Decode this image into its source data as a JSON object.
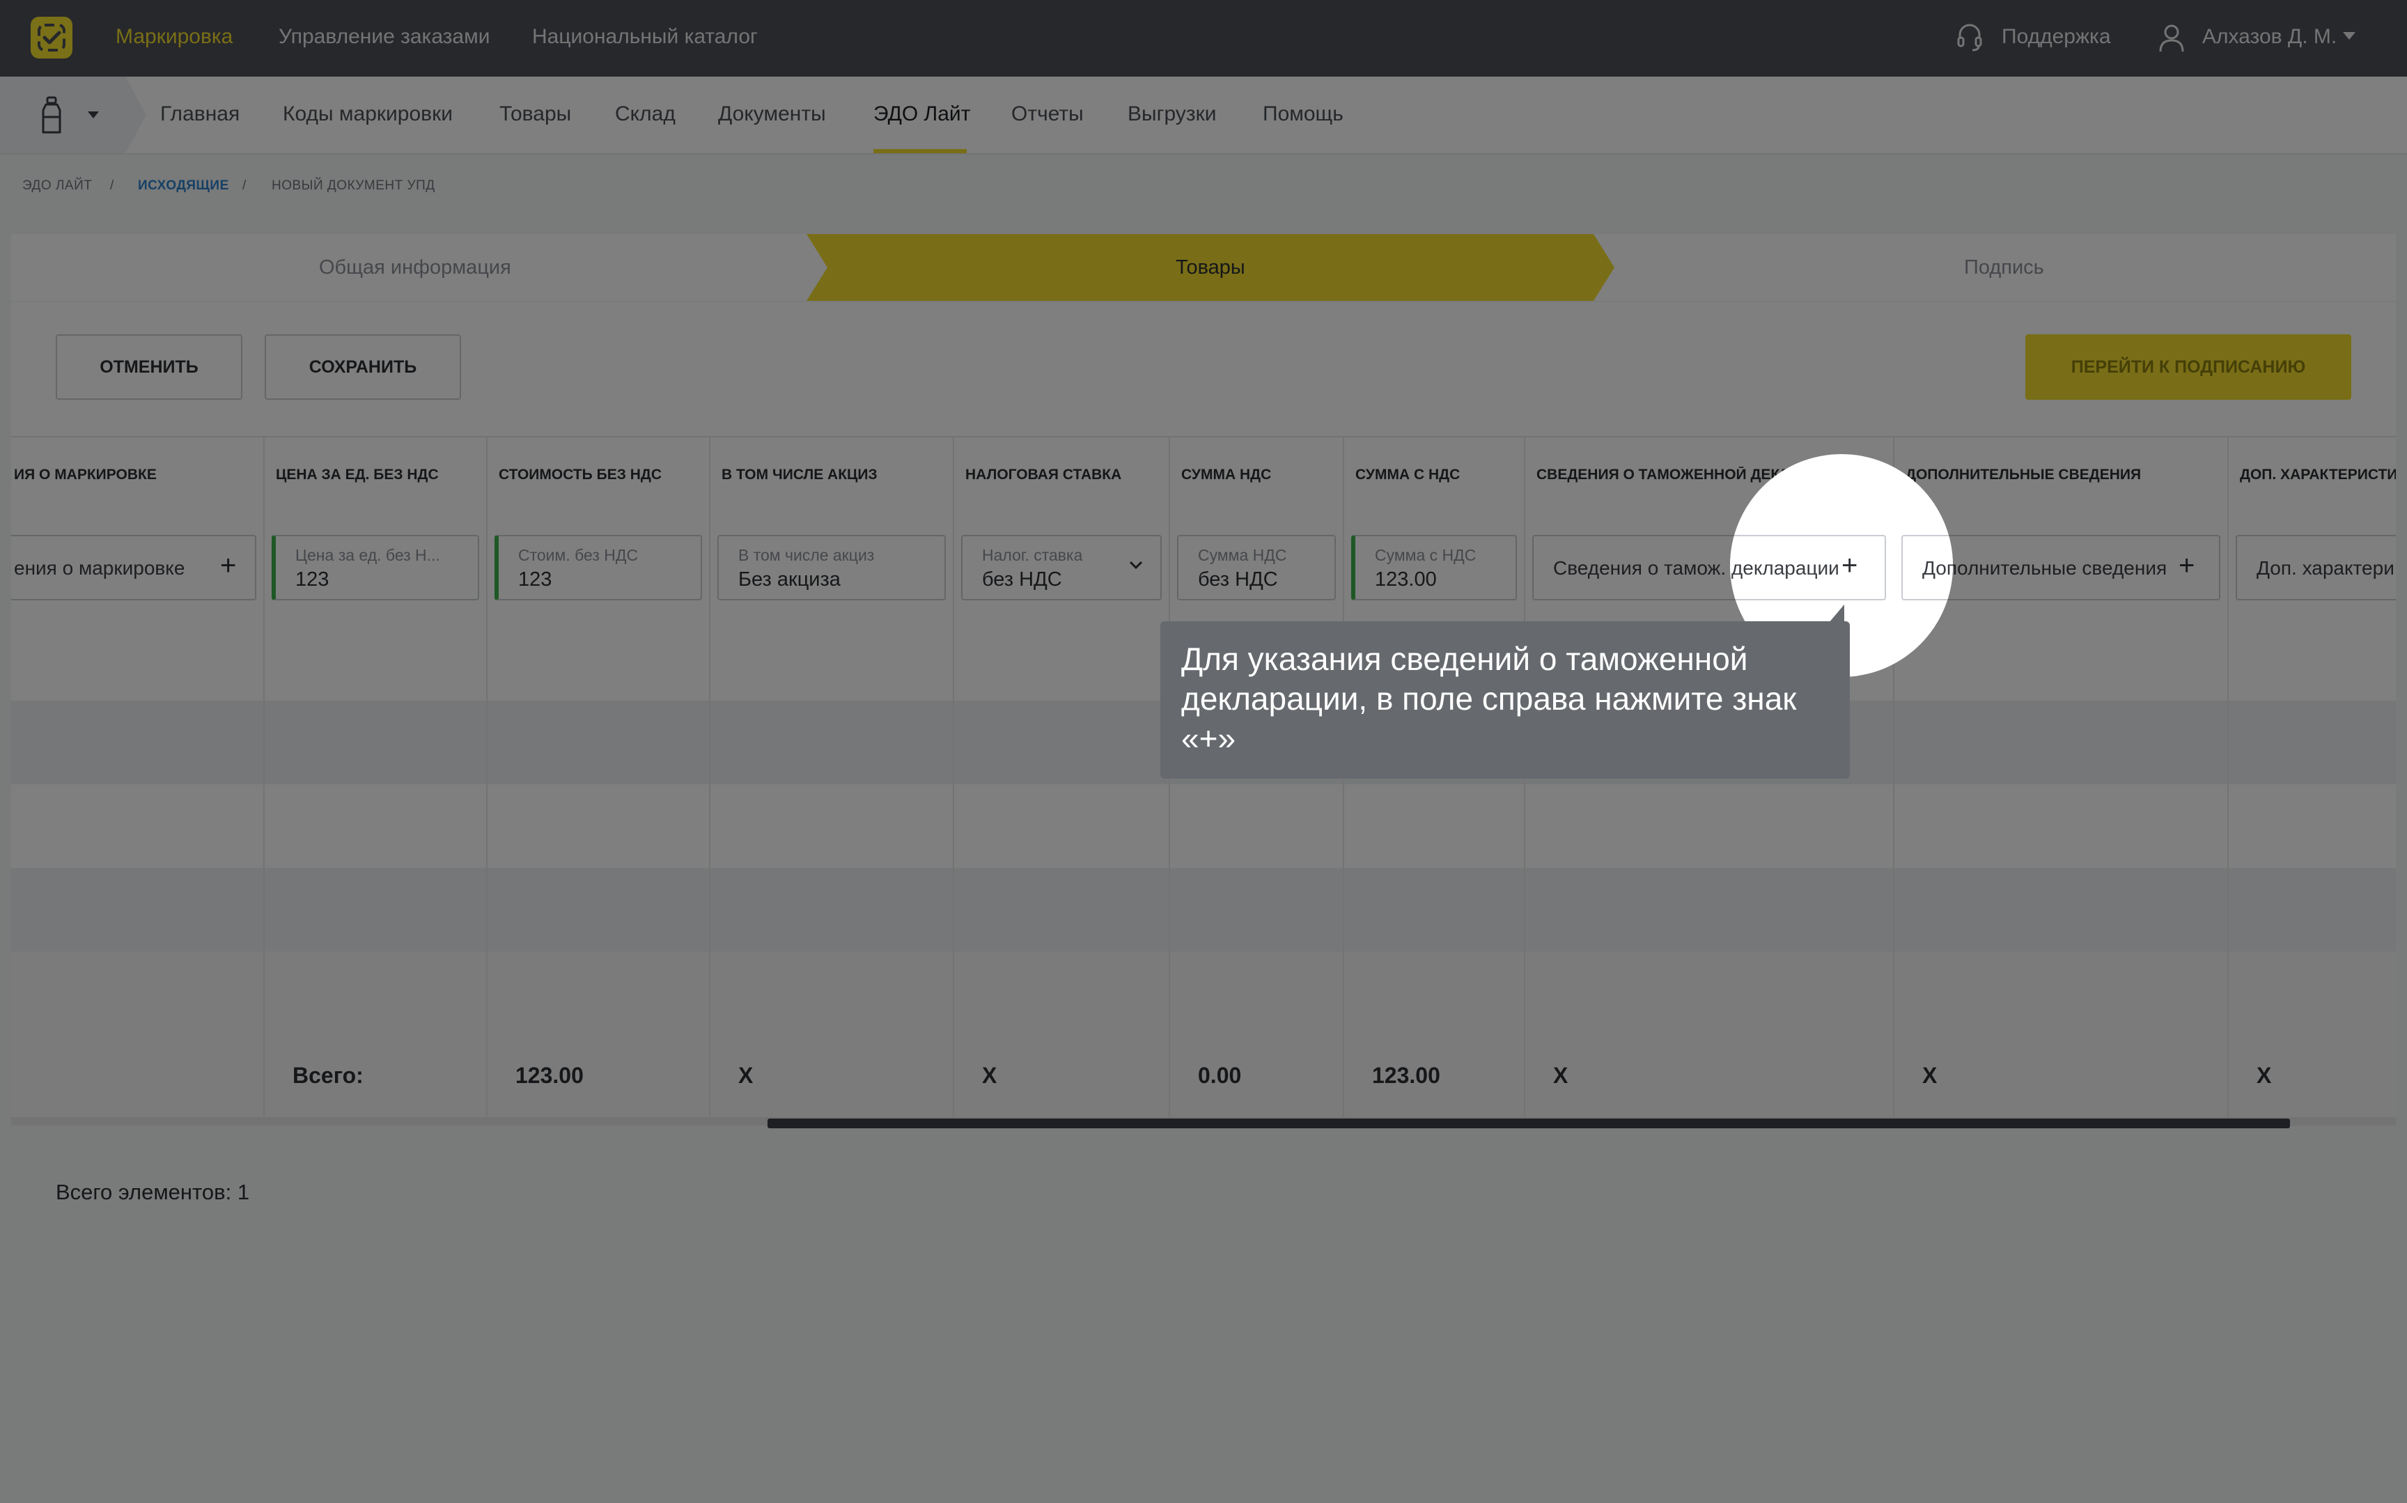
{
  "topbar": {
    "nav": [
      "Маркировка",
      "Управление заказами",
      "Национальный каталог"
    ],
    "support": "Поддержка",
    "user": "Алхазов Д. М."
  },
  "subnav": {
    "items": [
      "Главная",
      "Коды маркировки",
      "Товары",
      "Склад",
      "Документы",
      "ЭДО Лайт",
      "Отчеты",
      "Выгрузки",
      "Помощь"
    ],
    "active": "ЭДО Лайт"
  },
  "breadcrumb": [
    "ЭДО ЛАЙТ",
    "ИСХОДЯЩИЕ",
    "НОВЫЙ ДОКУМЕНТ УПД"
  ],
  "stepper": [
    "Общая информация",
    "Товары",
    "Подпись"
  ],
  "toolbar": {
    "cancel": "ОТМЕНИТЬ",
    "save": "СОХРАНИТЬ",
    "to_sign": "ПЕРЕЙТИ К ПОДПИСАНИЮ"
  },
  "table": {
    "headers": [
      "ИЯ О МАРКИРОВКЕ",
      "ЦЕНА ЗА ЕД. БЕЗ НДС",
      "СТОИМОСТЬ БЕЗ НДС",
      "В ТОМ ЧИСЛЕ АКЦИЗ",
      "НАЛОГОВАЯ СТАВКА",
      "СУММА НДС",
      "СУММА С НДС",
      "СВЕДЕНИЯ О ТАМОЖЕННОЙ ДЕКЛАРАЦИИ",
      "ДОПОЛНИТЕЛЬНЫЕ СВЕДЕНИЯ",
      "ДОП. ХАРАКТЕРИСТИ"
    ],
    "fields": {
      "marking": "ения о маркировке",
      "price_label": "Цена за ед. без Н...",
      "price_value": "123",
      "cost_label": "Стоим. без НДС",
      "cost_value": "123",
      "excise_label": "В том числе акциз",
      "excise_value": "Без акциза",
      "rate_label": "Налог. ставка",
      "rate_value": "без НДС",
      "vat_label": "Сумма НДС",
      "vat_value": "без НДС",
      "total_label": "Сумма с НДС",
      "total_value": "123.00",
      "customs": "Сведения о тамож. декларации",
      "extra": "Дополнительные сведения",
      "extra2": "Доп. характери"
    },
    "totals": {
      "label": "Всего:",
      "cost": "123.00",
      "excise": "X",
      "rate": "X",
      "vat": "0.00",
      "sum": "123.00",
      "customs": "X",
      "extra": "X",
      "extra2": "X"
    }
  },
  "count_text": "Всего элементов: 1",
  "tooltip": "Для указания сведений о таможенной декларации, в поле справа нажмите знак «+»",
  "colors": {
    "accent_yellow": "#f2dc2f",
    "topbar": "#4e5157",
    "input_accent": "#3cb04a"
  }
}
